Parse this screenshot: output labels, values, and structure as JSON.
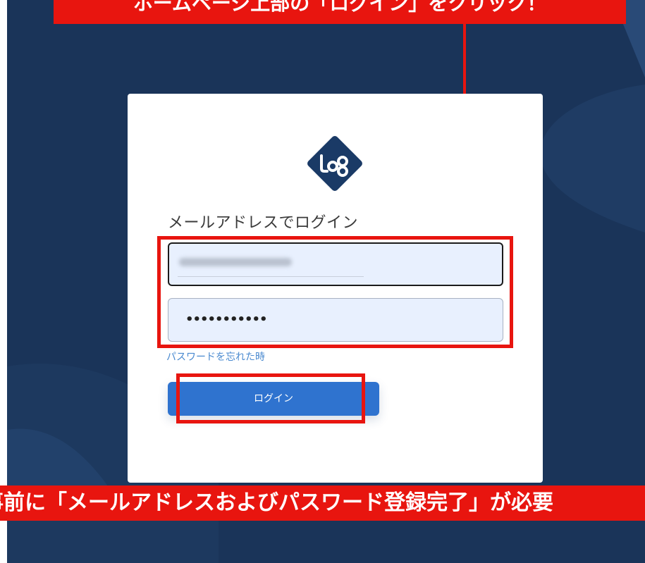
{
  "annotations": {
    "top_banner": "ホームページ上部の「ログイン」をクリック！",
    "bottom_banner": "事前に「メールアドレスおよびパスワード登録完了」が必要"
  },
  "login_form": {
    "heading": "メールアドレスでログイン",
    "email_value": "info@ecomo-hk.com",
    "password_mask": "•••••••••••",
    "forgot_password": "パスワードを忘れた時",
    "login_button": "ログイン"
  },
  "colors": {
    "background": "#1a3459",
    "annotation_red": "#e8150f",
    "button_blue": "#2f73cf",
    "link_blue": "#4a8ad0",
    "input_fill": "#e8f0fe",
    "logo_navy": "#1a3a66"
  },
  "icons": {
    "logo": "log-logo-icon",
    "arrow": "down-arrow-icon"
  }
}
